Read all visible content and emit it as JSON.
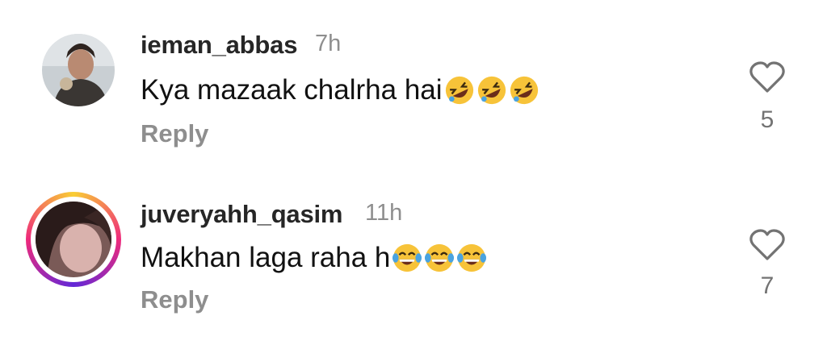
{
  "comments": [
    {
      "username": "ieman_abbas",
      "time": "7h",
      "text": "Kya mazaak chalrha hai",
      "emoji": [
        "rolling-on-floor-laughing",
        "rolling-on-floor-laughing",
        "rolling-on-floor-laughing"
      ],
      "reply_label": "Reply",
      "likes": "5",
      "has_story_ring": false
    },
    {
      "username": "juveryahh_qasim",
      "time": "11h",
      "text": "Makhan laga raha h",
      "emoji": [
        "face-with-tears-of-joy",
        "face-with-tears-of-joy",
        "face-with-tears-of-joy"
      ],
      "reply_label": "Reply",
      "likes": "7",
      "has_story_ring": true
    }
  ],
  "colors": {
    "username": "#262626",
    "meta": "#8e8e8e",
    "emoji_yellow": "#f7c339",
    "tear_blue": "#4aa3e0"
  }
}
